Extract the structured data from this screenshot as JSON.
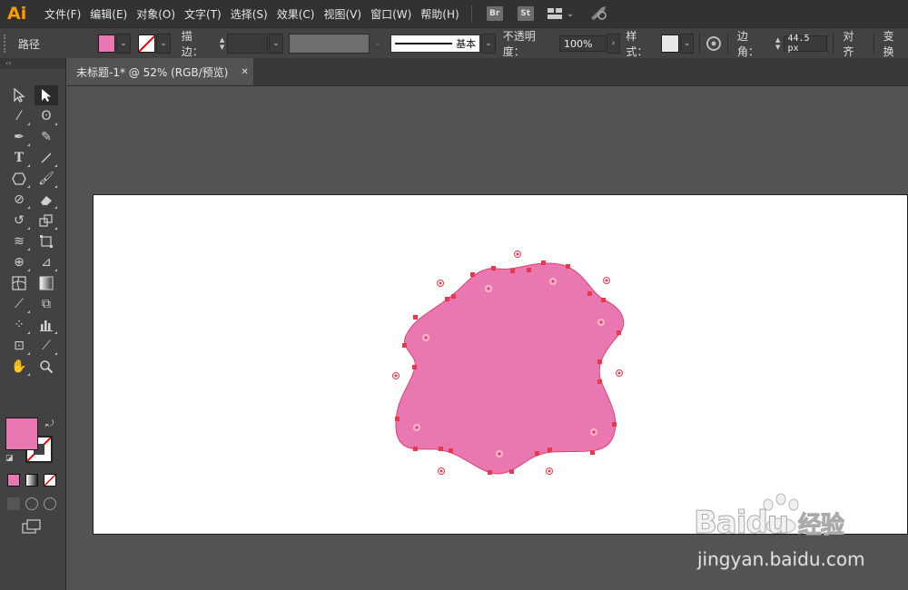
{
  "app": {
    "logo": "Ai"
  },
  "menu": {
    "items": [
      "文件(F)",
      "编辑(E)",
      "对象(O)",
      "文字(T)",
      "选择(S)",
      "效果(C)",
      "视图(V)",
      "窗口(W)",
      "帮助(H)"
    ],
    "bridge_label": "Br",
    "stock_label": "St"
  },
  "control": {
    "selection_type": "路径",
    "stroke_label": "描边：",
    "stroke_profile": "基本",
    "opacity_label": "不透明度：",
    "opacity_value": "100%",
    "style_label": "样式：",
    "corner_label": "边角：",
    "corner_value": "44.5 px",
    "align_label": "对齐",
    "transform_label": "变换"
  },
  "tab": {
    "title": "未标题-1* @ 52% (RGB/预览)",
    "close_glyph": "✕"
  },
  "colors": {
    "fill": "#e978b2",
    "fill_stroke": "#e0406a",
    "anchor": "#e8394c",
    "accent": "#ff9a00",
    "artboard": "#ffffff",
    "pasteboard": "#535353"
  },
  "watermark": {
    "brand": "Baidu",
    "brand_cn": "经验",
    "url": "jingyan.baidu.com"
  }
}
